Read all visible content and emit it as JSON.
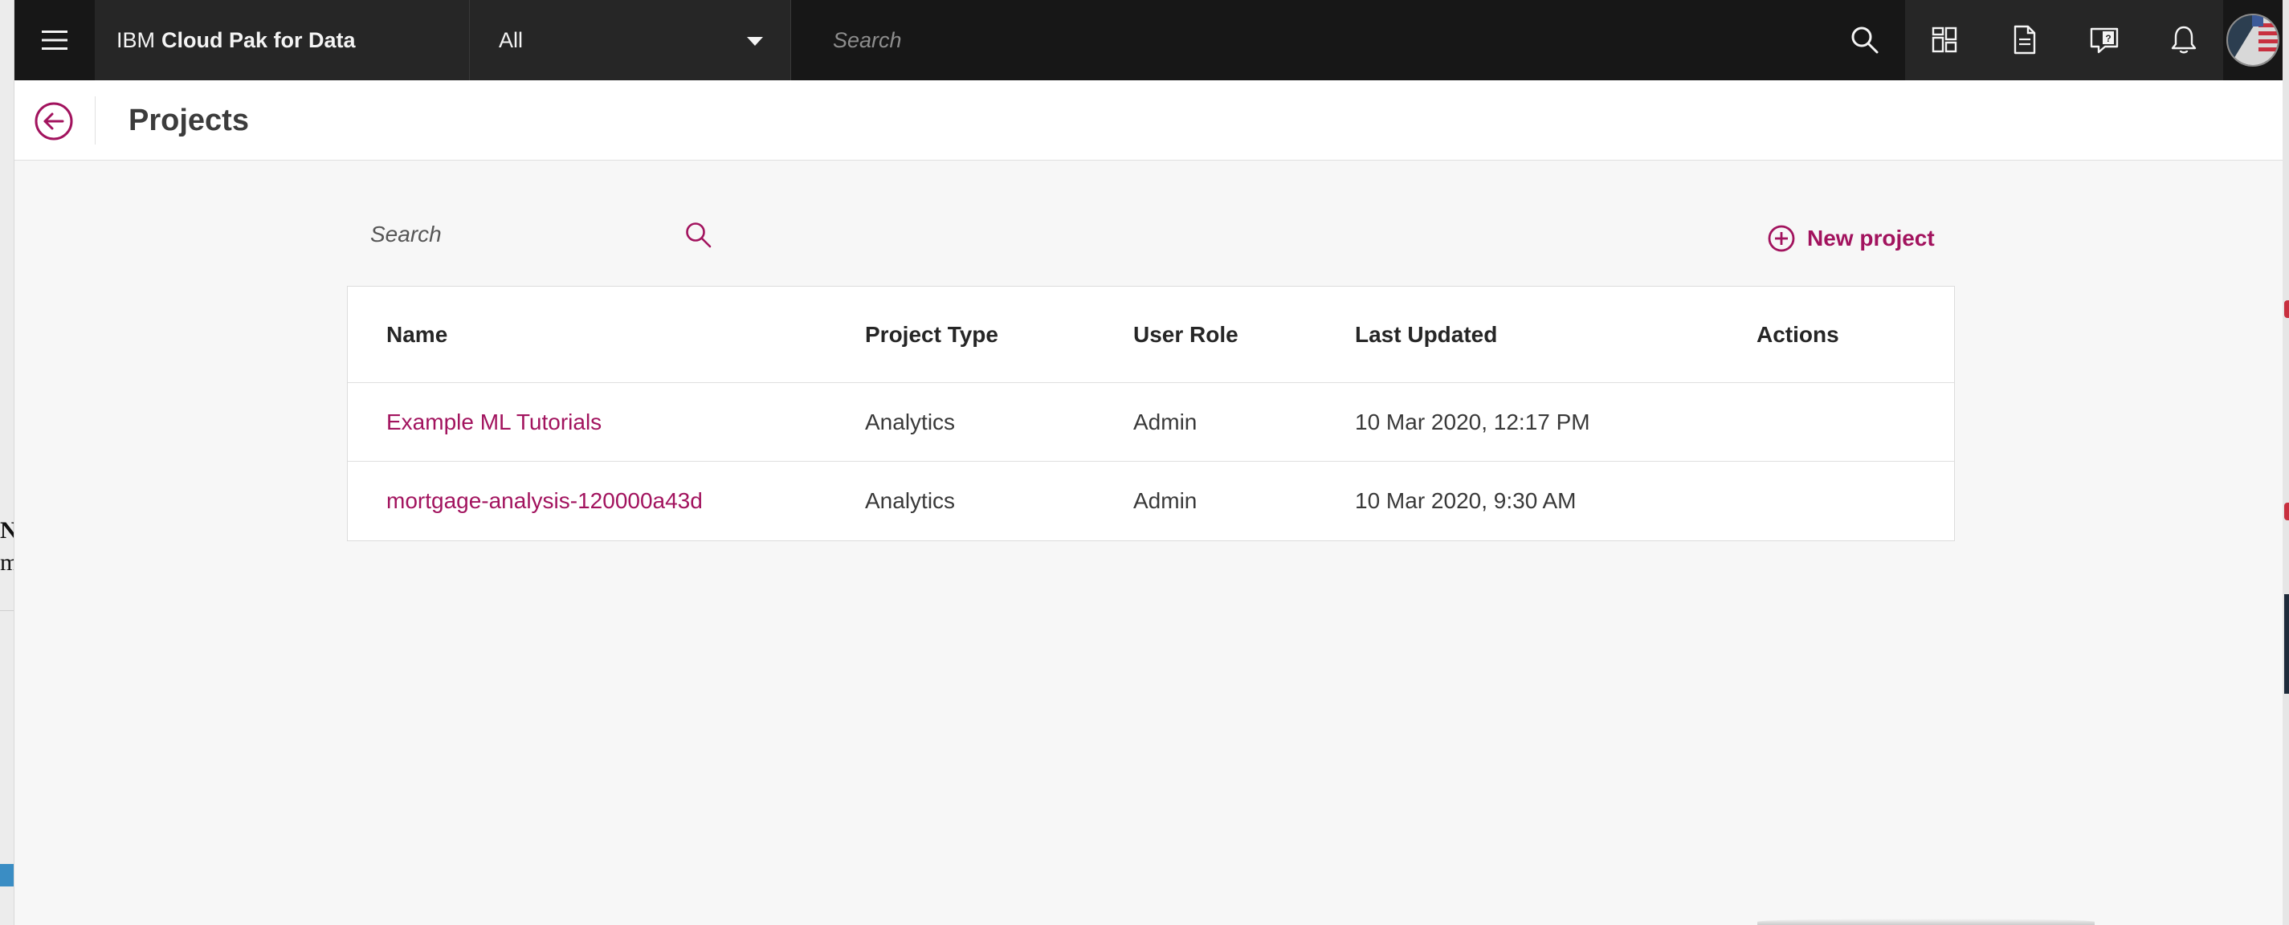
{
  "underlying_left": {
    "fragment_1": "N",
    "fragment_2": "m"
  },
  "topbar": {
    "brand_prefix": "IBM",
    "brand_name": "Cloud Pak for Data",
    "scope_value": "All",
    "search_placeholder": "Search",
    "icons": [
      "menu-icon",
      "search-icon",
      "apps-icon",
      "document-icon",
      "help-icon",
      "notification-icon",
      "avatar"
    ]
  },
  "header": {
    "title": "Projects"
  },
  "content": {
    "search_placeholder": "Search",
    "new_project_label": "New project"
  },
  "table": {
    "columns": [
      "Name",
      "Project Type",
      "User Role",
      "Last Updated",
      "Actions"
    ],
    "rows": [
      {
        "name": "Example ML Tutorials",
        "type": "Analytics",
        "role": "Admin",
        "updated": "10 Mar 2020, 12:17 PM",
        "actions": ""
      },
      {
        "name": "mortgage-analysis-120000a43d",
        "type": "Analytics",
        "role": "Admin",
        "updated": "10 Mar 2020, 9:30 AM",
        "actions": ""
      }
    ]
  },
  "colors": {
    "accent": "#a2135e",
    "topbar": "#171717",
    "topbar_secondary": "#262626",
    "background": "#f7f7f7"
  }
}
